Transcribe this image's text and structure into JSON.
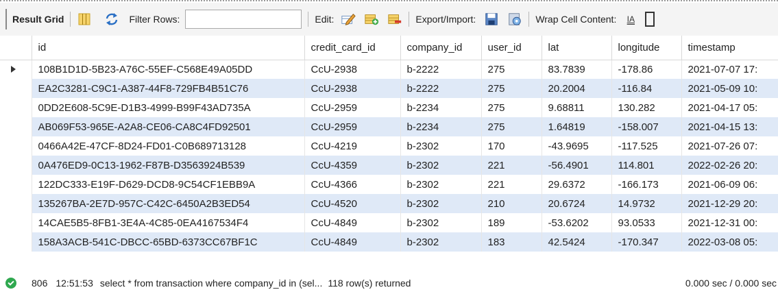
{
  "toolbar": {
    "result_grid_label": "Result Grid",
    "filter_rows_label": "Filter Rows:",
    "filter_rows_value": "",
    "edit_label": "Edit:",
    "export_import_label": "Export/Import:",
    "wrap_cell_label": "Wrap Cell Content:",
    "wrap_icon_text": "IA",
    "icons": [
      "grid-layout-icon",
      "refresh-icon",
      "edit-row-icon",
      "add-row-icon",
      "delete-row-icon",
      "export-icon",
      "import-icon",
      "wrap-cell-icon"
    ]
  },
  "grid": {
    "columns": [
      "id",
      "credit_card_id",
      "company_id",
      "user_id",
      "lat",
      "longitude",
      "timestamp"
    ],
    "rows": [
      [
        "108B1D1D-5B23-A76C-55EF-C568E49A05DD",
        "CcU-2938",
        "b-2222",
        "275",
        "83.7839",
        "-178.86",
        "2021-07-07 17:"
      ],
      [
        "EA2C3281-C9C1-A387-44F8-729FB4B51C76",
        "CcU-2938",
        "b-2222",
        "275",
        "20.2004",
        "-116.84",
        "2021-05-09 10:"
      ],
      [
        "0DD2E608-5C9E-D1B3-4999-B99F43AD735A",
        "CcU-2959",
        "b-2234",
        "275",
        "9.68811",
        "130.282",
        "2021-04-17 05:"
      ],
      [
        "AB069F53-965E-A2A8-CE06-CA8C4FD92501",
        "CcU-2959",
        "b-2234",
        "275",
        "1.64819",
        "-158.007",
        "2021-04-15 13:"
      ],
      [
        "0466A42E-47CF-8D24-FD01-C0B689713128",
        "CcU-4219",
        "b-2302",
        "170",
        "-43.9695",
        "-117.525",
        "2021-07-26 07:"
      ],
      [
        "0A476ED9-0C13-1962-F87B-D3563924B539",
        "CcU-4359",
        "b-2302",
        "221",
        "-56.4901",
        "114.801",
        "2022-02-26 20:"
      ],
      [
        "122DC333-E19F-D629-DCD8-9C54CF1EBB9A",
        "CcU-4366",
        "b-2302",
        "221",
        "29.6372",
        "-166.173",
        "2021-06-09 06:"
      ],
      [
        "135267BA-2E7D-957C-C42C-6450A2B3ED54",
        "CcU-4520",
        "b-2302",
        "210",
        "20.6724",
        "14.9732",
        "2021-12-29 20:"
      ],
      [
        "14CAE5B5-8FB1-3E4A-4C85-0EA4167534F4",
        "CcU-4849",
        "b-2302",
        "189",
        "-53.6202",
        "93.0533",
        "2021-12-31 00:"
      ],
      [
        "158A3ACB-541C-DBCC-65BD-6373CC67BF1C",
        "CcU-4849",
        "b-2302",
        "183",
        "42.5424",
        "-170.347",
        "2022-03-08 05:"
      ]
    ]
  },
  "status": {
    "query_number": "806",
    "time": "12:51:53",
    "action": "select * from transaction where company_id in (sel...",
    "message": "118 row(s) returned",
    "duration": "0.000 sec / 0.000 sec"
  },
  "colors": {
    "alt_row": "#dfe9f7",
    "toolbar_bg": "#f4f4f4",
    "status_ok": "#2fa84f"
  }
}
